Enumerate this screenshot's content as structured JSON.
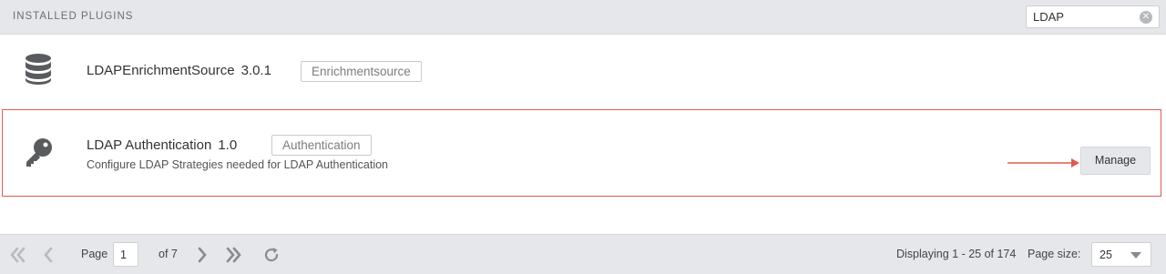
{
  "header": {
    "title": "INSTALLED PLUGINS",
    "search": {
      "value": "LDAP",
      "clear_icon": "clear-icon",
      "clear_glyph": "✕"
    }
  },
  "plugins": [
    {
      "icon": "database-icon",
      "name": "LDAPEnrichmentSource",
      "version": "3.0.1",
      "tag": "Enrichmentsource",
      "description": ""
    },
    {
      "icon": "key-icon",
      "name": "LDAP Authentication",
      "version": "1.0",
      "tag": "Authentication",
      "description": "Configure LDAP Strategies needed for LDAP Authentication",
      "manage_label": "Manage",
      "highlighted": true
    }
  ],
  "pagination": {
    "page_label": "Page",
    "current_page": "1",
    "of_label": "of 7",
    "display_text": "Displaying 1 - 25 of 174",
    "page_size_label": "Page size:",
    "page_size": "25",
    "icons": [
      "first-page-icon",
      "previous-page-icon",
      "next-page-icon",
      "last-page-icon",
      "refresh-icon"
    ]
  },
  "colors": {
    "highlight_border": "#e05a4f",
    "header_bg": "#e6e7eb",
    "icon_gray": "#5a5b5f",
    "disabled_gray": "#b9babe",
    "enabled_gray": "#8a8b8f"
  }
}
